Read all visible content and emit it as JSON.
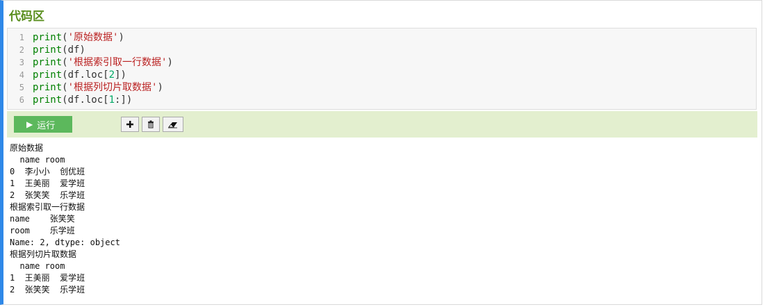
{
  "title": "代码区",
  "editor": {
    "line_numbers": [
      "1",
      "2",
      "3",
      "4",
      "5",
      "6"
    ],
    "lines": [
      "print('原始数据')",
      "print(df)",
      "print('根据索引取一行数据')",
      "print(df.loc[2])",
      "print('根据列切片取数据')",
      "print(df.loc[1:])"
    ]
  },
  "toolbar": {
    "run_label": "运行",
    "run_icon": "play-icon",
    "add_icon": "plus-icon",
    "delete_icon": "trash-icon",
    "clear_icon": "eraser-icon"
  },
  "output": {
    "lines": [
      "原始数据",
      "  name room",
      "0  李小小  创优班",
      "1  王美丽  爱学班",
      "2  张笑笑  乐学班",
      "根据索引取一行数据",
      "name    张笑笑",
      "room    乐学班",
      "Name: 2, dtype: object",
      "根据列切片取数据",
      "  name room",
      "1  王美丽  爱学班",
      "2  张笑笑  乐学班"
    ]
  },
  "colors": {
    "accent_border": "#2f88e8",
    "title_green": "#5a8f1f",
    "run_button": "#5cb85c",
    "toolbar_bg": "#e3efcf"
  }
}
